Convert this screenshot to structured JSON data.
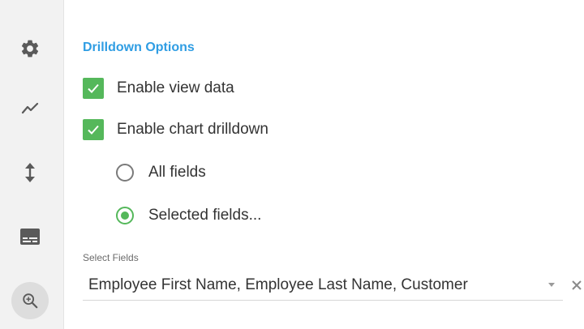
{
  "sidebar": {
    "items": [
      {
        "icon": "gear-icon"
      },
      {
        "icon": "trend-line-icon"
      },
      {
        "icon": "vertical-arrows-icon"
      },
      {
        "icon": "subtitles-icon"
      },
      {
        "icon": "zoom-in-icon",
        "active": true
      }
    ]
  },
  "drilldown": {
    "title": "Drilldown Options",
    "enable_view_data": {
      "label": "Enable view data",
      "checked": true
    },
    "enable_chart_drilldown": {
      "label": "Enable chart drilldown",
      "checked": true
    },
    "radio_all": {
      "label": "All fields",
      "selected": false
    },
    "radio_selected": {
      "label": "Selected fields...",
      "selected": true
    }
  },
  "select_fields": {
    "caption": "Select Fields",
    "value": "Employee First Name, Employee Last Name, Customer"
  },
  "colors": {
    "accent_blue": "#2f9de3",
    "check_green": "#55b85b"
  }
}
